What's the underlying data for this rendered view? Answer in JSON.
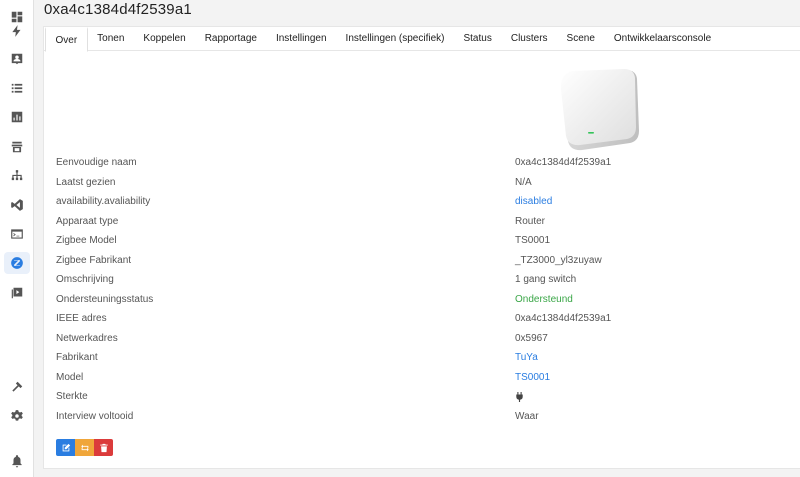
{
  "page": {
    "title": "0xa4c1384d4f2539a1"
  },
  "sidebar": {
    "items": [
      {
        "name": "dashboard-icon"
      },
      {
        "name": "lightning-icon"
      },
      {
        "name": "devices-icon"
      },
      {
        "name": "list-icon"
      },
      {
        "name": "chart-icon"
      },
      {
        "name": "store-icon"
      },
      {
        "name": "network-map-icon"
      },
      {
        "name": "vscode-icon"
      },
      {
        "name": "terminal-icon"
      },
      {
        "name": "zigbee-icon",
        "active": true
      },
      {
        "name": "media-icon"
      },
      {
        "name": "hammer-icon"
      },
      {
        "name": "settings-icon"
      },
      {
        "name": "bell-icon"
      }
    ]
  },
  "tabs": [
    {
      "label": "Over",
      "active": true
    },
    {
      "label": "Tonen"
    },
    {
      "label": "Koppelen"
    },
    {
      "label": "Rapportage"
    },
    {
      "label": "Instellingen"
    },
    {
      "label": "Instellingen (specifiek)"
    },
    {
      "label": "Status"
    },
    {
      "label": "Clusters"
    },
    {
      "label": "Scene"
    },
    {
      "label": "Ontwikkelaarsconsole"
    }
  ],
  "details": [
    {
      "label": "Eenvoudige naam",
      "value": "0xa4c1384d4f2539a1"
    },
    {
      "label": "Laatst gezien",
      "value": "N/A"
    },
    {
      "label": "availability.avaliability",
      "value": "disabled",
      "style": "link"
    },
    {
      "label": "Apparaat type",
      "value": "Router"
    },
    {
      "label": "Zigbee Model",
      "value": "TS0001"
    },
    {
      "label": "Zigbee Fabrikant",
      "value": "_TZ3000_yl3zuyaw"
    },
    {
      "label": "Omschrijving",
      "value": "1 gang switch"
    },
    {
      "label": "Ondersteuningsstatus",
      "value": "Ondersteund",
      "style": "ok"
    },
    {
      "label": "IEEE adres",
      "value": "0xa4c1384d4f2539a1"
    },
    {
      "label": "Netwerkadres",
      "value": "0x5967"
    },
    {
      "label": "Fabrikant",
      "value": "TuYa",
      "style": "link"
    },
    {
      "label": "Model",
      "value": "TS0001",
      "style": "link"
    },
    {
      "label": "Sterkte",
      "value": "",
      "icon": "plug-icon"
    },
    {
      "label": "Interview voltooid",
      "value": "Waar"
    }
  ],
  "colors": {
    "accent": "#2a7de1",
    "success": "#3aa647",
    "warning": "#f0a63a",
    "danger": "#db3b3b"
  }
}
